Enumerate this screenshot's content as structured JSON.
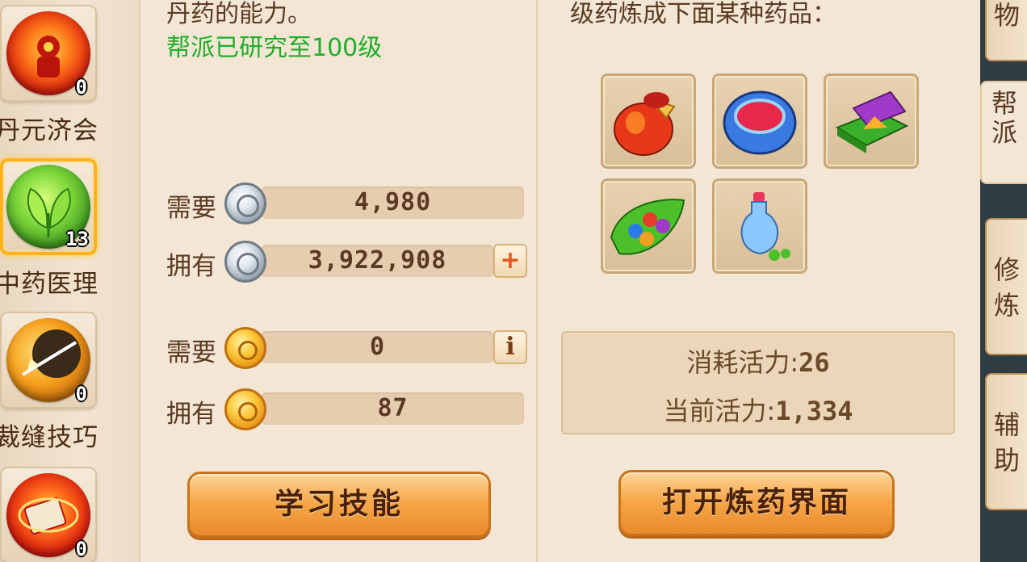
{
  "skills": [
    {
      "label": "丹元济会",
      "count": "0",
      "icon": "dan-yuan-icon",
      "color": "#e8401a",
      "active": false
    },
    {
      "label": "中药医理",
      "count": "13",
      "icon": "herb-leaf-icon",
      "color": "#4cbf2a",
      "active": true
    },
    {
      "label": "裁缝技巧",
      "count": "0",
      "icon": "sewing-icon",
      "color": "#f0a020",
      "active": false
    },
    {
      "label": "",
      "count": "0",
      "icon": "fire-scroll-icon",
      "color": "#e0301a",
      "active": false
    }
  ],
  "middle": {
    "desc_line1": "丹药的能力。",
    "desc_line2": "帮派已研究至100级",
    "cost_rows": [
      {
        "label": "需要",
        "currency": "silver-coin-icon",
        "value": "4,980"
      },
      {
        "label": "拥有",
        "currency": "silver-coin-icon",
        "value": "3,922,908",
        "action": "+"
      },
      {
        "label": "需要",
        "currency": "gold-coin-icon",
        "value": "0",
        "action": "i"
      },
      {
        "label": "拥有",
        "currency": "gold-coin-icon",
        "value": "87"
      }
    ],
    "learn_button": "学习技能"
  },
  "right": {
    "desc_line": "级药炼成下面某种药品：",
    "items": [
      "red-pouch-icon",
      "blue-ring-icon",
      "purple-box-icon",
      "jewel-leaf-icon",
      "blue-bottle-icon"
    ],
    "consume_label": "消耗活力:",
    "consume_value": "26",
    "current_label": "当前活力:",
    "current_value": "1,334",
    "open_button": "打开炼药界面"
  },
  "tabs": [
    {
      "label": "物"
    },
    {
      "label": "帮派"
    },
    {
      "label": "修炼"
    },
    {
      "label": "辅助"
    }
  ],
  "colors": {
    "accent_green": "#1fae2a",
    "text_brown": "#5b3a22",
    "button_orange": "#f7a84a",
    "panel_bg": "#f3e6d4"
  }
}
